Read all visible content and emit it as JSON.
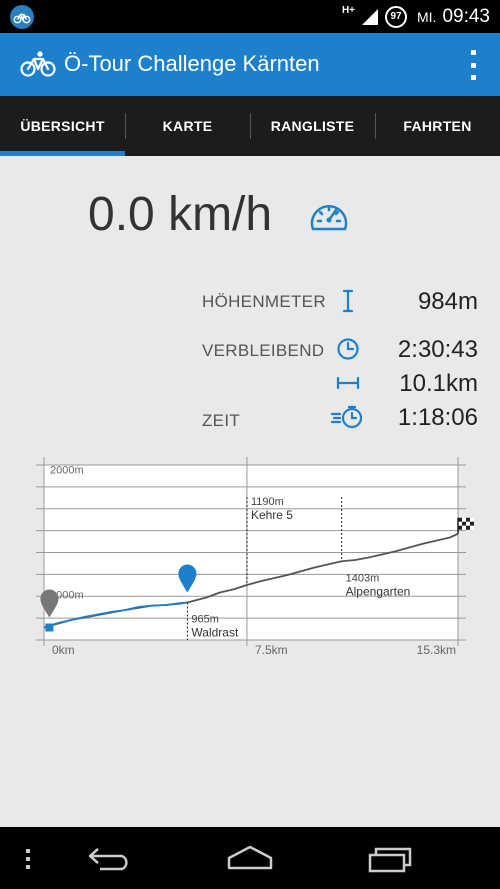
{
  "status_bar": {
    "network_label": "H+",
    "battery_level": "97",
    "day": "MI.",
    "time": "09:43",
    "left_icon": "bicycle-notification-icon"
  },
  "app_bar": {
    "icon": "bicycle-icon",
    "title": "Ö-Tour Challenge Kärnten",
    "menu_icon": "overflow-menu-icon"
  },
  "tabs": [
    {
      "label": "ÜBERSICHT",
      "active": true
    },
    {
      "label": "KARTE",
      "active": false
    },
    {
      "label": "RANGLISTE",
      "active": false
    },
    {
      "label": "FAHRTEN",
      "active": false
    }
  ],
  "speed": {
    "value": "0.0 km/h",
    "icon": "speedometer-icon"
  },
  "stats": {
    "elevation": {
      "label": "HÖHENMETER",
      "value": "984m",
      "icon": "elevation-icon"
    },
    "remaining": {
      "label": "VERBLEIBEND",
      "value": "2:30:43",
      "icon": "clock-icon"
    },
    "distance": {
      "label": "",
      "value": "10.1km",
      "icon": "distance-icon"
    },
    "time": {
      "label": "ZEIT",
      "value": "1:18:06",
      "icon": "stopwatch-icon"
    }
  },
  "accent_color": "#1d80cc",
  "chart_data": {
    "type": "line",
    "title": "",
    "xlabel": "",
    "ylabel": "",
    "x_ticks": [
      "0km",
      "7.5km",
      "15.3km"
    ],
    "y_ticks": [
      "1000m",
      "2000m"
    ],
    "xlim": [
      0,
      15.3
    ],
    "ylim": [
      700,
      2100
    ],
    "series": [
      {
        "role": "profile",
        "color": "#555555",
        "x": [
          0,
          1,
          2,
          3,
          4,
          4.5,
          5,
          5.3,
          6,
          6.5,
          7,
          7.5,
          8,
          9,
          10,
          11,
          11.5,
          12,
          13,
          14,
          15,
          15.3
        ],
        "y": [
          800,
          860,
          900,
          940,
          975,
          980,
          990,
          1000,
          1040,
          1080,
          1105,
          1140,
          1170,
          1220,
          1280,
          1330,
          1340,
          1360,
          1410,
          1470,
          1520,
          1550
        ]
      },
      {
        "role": "ridden",
        "color": "#1d80cc",
        "x": [
          0,
          0.5,
          1,
          1.5,
          2,
          2.5,
          3,
          3.5,
          4,
          4.5,
          5,
          5.3
        ],
        "y": [
          800,
          835,
          860,
          885,
          905,
          925,
          940,
          965,
          975,
          980,
          995,
          1000
        ]
      }
    ],
    "annotations": [
      {
        "x": 5.3,
        "y": 1000,
        "line1": "965m",
        "line2": "Waldrast"
      },
      {
        "x": 7.5,
        "y": 1140,
        "line1": "1190m",
        "line2": "Kehre 5"
      },
      {
        "x": 11,
        "y": 1330,
        "line1": "1403m",
        "line2": "Alpengarten"
      }
    ],
    "markers": [
      {
        "type": "start-pin",
        "color": "#777777",
        "x": 0.2,
        "y": 800
      },
      {
        "type": "position-pin",
        "color": "#1d80cc",
        "x": 5.3,
        "y": 1000
      },
      {
        "type": "finish-flag",
        "x": 15.3,
        "y": 1550
      }
    ],
    "grid": true
  }
}
